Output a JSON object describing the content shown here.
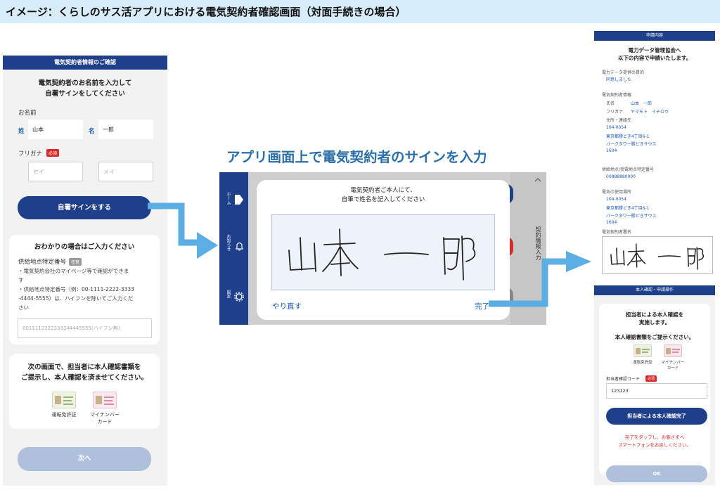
{
  "banner": {
    "title": "イメージ：くらしのサス活アプリにおける電気契約者確認画面（対面手続きの場合）"
  },
  "center_title": "アプリ画面上で電気契約者のサインを入力",
  "left_screen": {
    "header": "電気契約者情報のご確認",
    "instruction_line1": "電気契約者のお名前を入力して",
    "instruction_line2": "自署サインをしてください",
    "name_label": "お名前",
    "sei_label": "姓",
    "sei_value": "山本",
    "mei_label": "名",
    "mei_value": "一郎",
    "furigana_label": "フリガナ",
    "required_badge": "必須",
    "sei_placeholder": "セイ",
    "mei_placeholder": "メイ",
    "sign_button": "自署サインをする",
    "info_card": {
      "title": "おわかりの場合はご入力ください",
      "field_label": "供給地点特定番号",
      "optional_badge": "任意",
      "note1_line1": "・電気契約会社のマイページ等で確認ができま",
      "note1_line2": "す",
      "note2_line1": "・供給地点特定番号（例：00-1111-2222-3333",
      "note2_line2": "-4444-5555）は、ハイフンを除いてご入力くだ",
      "note2_line3": "さい",
      "input_placeholder": "0011112222333344445555(ハイフン無)"
    },
    "id_card": {
      "line1": "次の画面で、担当者に本人確認書類を",
      "line2": "ご提示し、本人確認を済ませてください。",
      "doc1": "運転免許証",
      "doc2_line1": "マイナンバー",
      "doc2_line2": "カード"
    },
    "next_button": "次へ"
  },
  "tablet": {
    "sidebar": [
      "ホーム",
      "お知らせ",
      "設定"
    ],
    "right_label": "契約情報入力",
    "dialog_line1": "電気契約者ご本人にて、",
    "dialog_line2": "自筆で姓名を記入してください",
    "signature": "山本 一郎",
    "redo": "やり直す",
    "done": "完了"
  },
  "right_screen": {
    "header1": "申請内容",
    "intro_line1": "電力データ管理協会へ",
    "intro_line2": "以下の内容で申請いたします。",
    "purpose_label": "電力データ提供の目的",
    "purpose_value": "同意しました",
    "contract_info_label": "電気契約者情報",
    "name_row_label": "氏名",
    "name_row_value": "山本　一郎",
    "kana_row_label": "フリガナ",
    "kana_row_value": "ヤマモト　イチロウ",
    "address_label": "住所・連絡先",
    "address_lines": [
      "104-0054",
      "東京都勝どき4丁目6-1",
      "パークタワー勝どきサウス",
      "1604"
    ],
    "supply_label": "供給地点/受電地点特定番号",
    "supply_value": "00888880000",
    "usage_label": "電気の使用場所",
    "usage_lines": [
      "104-0054",
      "東京都勝どき4丁目6-1",
      "パークタワー勝どきサウス",
      "1604"
    ],
    "sign_label": "電気契約者署名",
    "signature": "山本 一郎",
    "header2": "本人確認・申請操作",
    "staff_line1": "担当者による本人確認を",
    "staff_line2": "実施します。",
    "present_line": "本人確認書類をご提示ください。",
    "doc1": "運転免許証",
    "doc2_line1": "マイナンバー",
    "doc2_line2": "カード",
    "staff_code_label": "担当者確認コード",
    "required_badge": "必須",
    "staff_code_value": "123123",
    "complete_button": "担当者による本人確認完了",
    "note_line1": "完了をタップし、お客さまへ",
    "note_line2": "スマートフォンをお戻しください。",
    "ok_button": "OK"
  },
  "colors": {
    "navy": "#1e3f8a",
    "link_blue": "#1e5bb8",
    "arrow_blue": "#5aaee3",
    "disabled_button": "#aec0dc",
    "required_red": "#d92a2a",
    "banner_bg": "#d6ecf9"
  }
}
